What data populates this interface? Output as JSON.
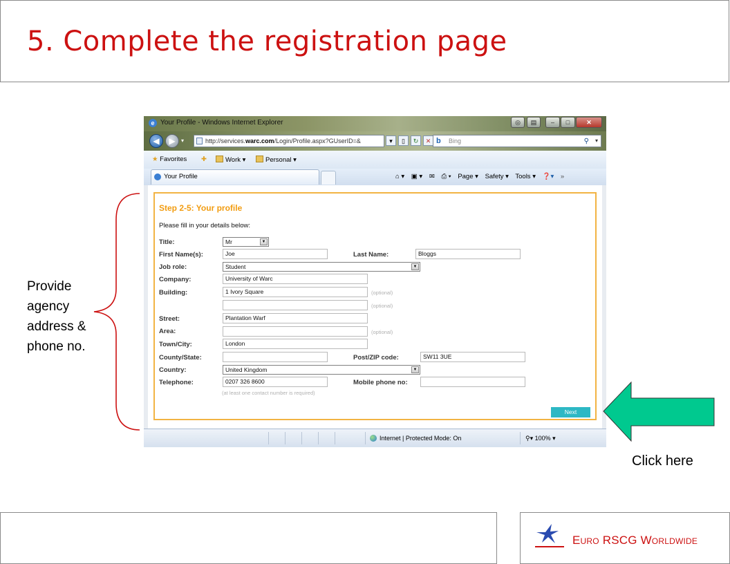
{
  "slide": {
    "title": "5. Complete the registration page",
    "annotation": [
      "Provide",
      "agency",
      "address &",
      "phone no."
    ],
    "click_label": "Click here",
    "logo_text": "Euro RSCG Worldwide",
    "colors": {
      "title": "#cc1111",
      "arrow": "#00c98f",
      "brace": "#cc1111"
    }
  },
  "browser": {
    "window_title": "Your Profile - Windows Internet Explorer",
    "url_prefix": "http://services.",
    "url_domain": "warc.com",
    "url_suffix": "/Login/Profile.aspx?GUserID=&",
    "search_placeholder": "Bing",
    "favorites": {
      "label": "Favorites",
      "work": "Work ▾",
      "personal": "Personal ▾"
    },
    "tab_label": "Your Profile",
    "commands": {
      "page": "Page ▾",
      "safety": "Safety ▾",
      "tools": "Tools ▾"
    },
    "status": {
      "zone": "Internet | Protected Mode: On",
      "zoom": "100%"
    }
  },
  "form": {
    "heading": "Step 2-5: Your profile",
    "intro": "Please fill in your details below:",
    "labels": {
      "title": "Title:",
      "first_name": "First Name(s):",
      "last_name": "Last Name:",
      "job_role": "Job role:",
      "company": "Company:",
      "building": "Building:",
      "street": "Street:",
      "area": "Area:",
      "town": "Town/City:",
      "county": "County/State:",
      "postcode": "Post/ZIP code:",
      "country": "Country:",
      "telephone": "Telephone:",
      "mobile": "Mobile phone no:"
    },
    "values": {
      "title": "Mr",
      "first_name": "Joe",
      "last_name": "Bloggs",
      "job_role": "Student",
      "company": "University of Warc",
      "building": "1 Ivory Square",
      "building2": "",
      "street": "Plantation Warf",
      "area": "",
      "town": "London",
      "county": "",
      "postcode": "SW11 3UE",
      "country": "United Kingdom",
      "telephone": "0207 326 8600",
      "mobile": ""
    },
    "optional": "(optional)",
    "contact_hint": "(at least one contact number is required)",
    "next_label": "Next"
  }
}
